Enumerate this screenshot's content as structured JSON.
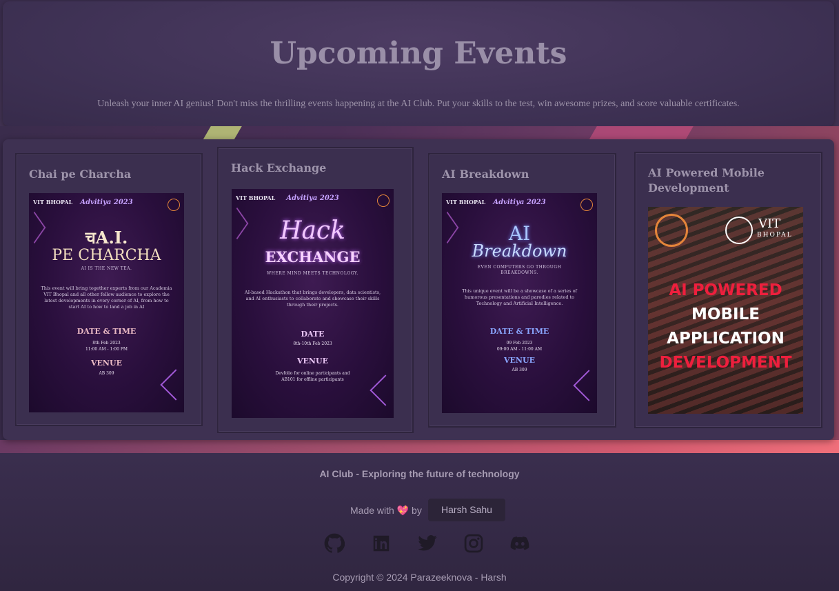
{
  "hero": {
    "title": "Upcoming Events",
    "subtitle": "Unleash your inner AI genius! Don't miss the thrilling events happening at the AI Club. Put your skills to the test, win awesome prizes, and score valuable certificates."
  },
  "events": [
    {
      "title": "Chai pe Charcha",
      "poster": {
        "logo_left": "VIT BHOPAL",
        "logo_mid": "Advitiya 2023",
        "heading_1": "चA.I.",
        "heading_2": "PE CHARCHA",
        "tagline": "AI IS THE NEW TEA.",
        "description": "This event will bring together experts from our Academia VIT Bhopal and all other fellow audience to explore the latest developments in every corner of AI, from how to start AI to how to land a job in AI",
        "date_head": "DATE & TIME",
        "date_line1": "8th Feb 2023",
        "date_line2": "11:00 AM - 1:00 PM",
        "venue_head": "VENUE",
        "venue_line": "AB 309"
      }
    },
    {
      "title": "Hack Exchange",
      "poster": {
        "logo_left": "VIT BHOPAL",
        "logo_mid": "Advitiya 2023",
        "heading_1": "Hack",
        "heading_2": "EXCHANGE",
        "tagline": "WHERE MIND MEETS TECHNOLOGY.",
        "description": "AI-based Hackathon that brings developers, data scientists, and AI enthusiasts to collaborate and showcase their skills through their projects.",
        "date_head": "DATE",
        "date_line1": "8th-10th Feb 2023",
        "venue_head": "VENUE",
        "venue_line1": "Devfolio for online participants and",
        "venue_line2": "AB101 for offline participants"
      }
    },
    {
      "title": "AI Breakdown",
      "poster": {
        "logo_left": "VIT BHOPAL",
        "logo_mid": "Advitiya 2023",
        "heading_1": "AI",
        "heading_2": "Breakdown",
        "tagline_1": "EVEN COMPUTERS GO THROUGH",
        "tagline_2": "BREAKDOWNS.",
        "description": "This unique event will be a showcase of a series of humorous presentations and parodies related to Technology and Artificial Intelligence.",
        "date_head": "DATE & TIME",
        "date_line1": "09 Feb 2023",
        "date_line2": "09:00 AM - 11:00 AM",
        "venue_head": "VENUE",
        "venue_line": "AB 309"
      }
    },
    {
      "title": "AI Powered Mobile Development",
      "poster": {
        "logo_right": "VIT",
        "logo_right_sub": "BHOPAL",
        "line1": "AI POWERED",
        "line2": "MOBILE",
        "line3": "APPLICATION",
        "line4": "DEVELOPMENT"
      }
    }
  ],
  "footer": {
    "tagline": "AI Club - Exploring the future of technology",
    "made_with": "Made with",
    "heart": "💖",
    "by": "by",
    "author": "Harsh Sahu",
    "social_icons": [
      "github-icon",
      "linkedin-icon",
      "twitter-icon",
      "instagram-icon",
      "discord-icon"
    ],
    "copyright": "Copyright © 2024 Parazeeknova - Harsh"
  },
  "colors": {
    "background": "#3a2d4d",
    "accent_pink": "#ee1f3d",
    "neon_purple": "#c06bff"
  }
}
